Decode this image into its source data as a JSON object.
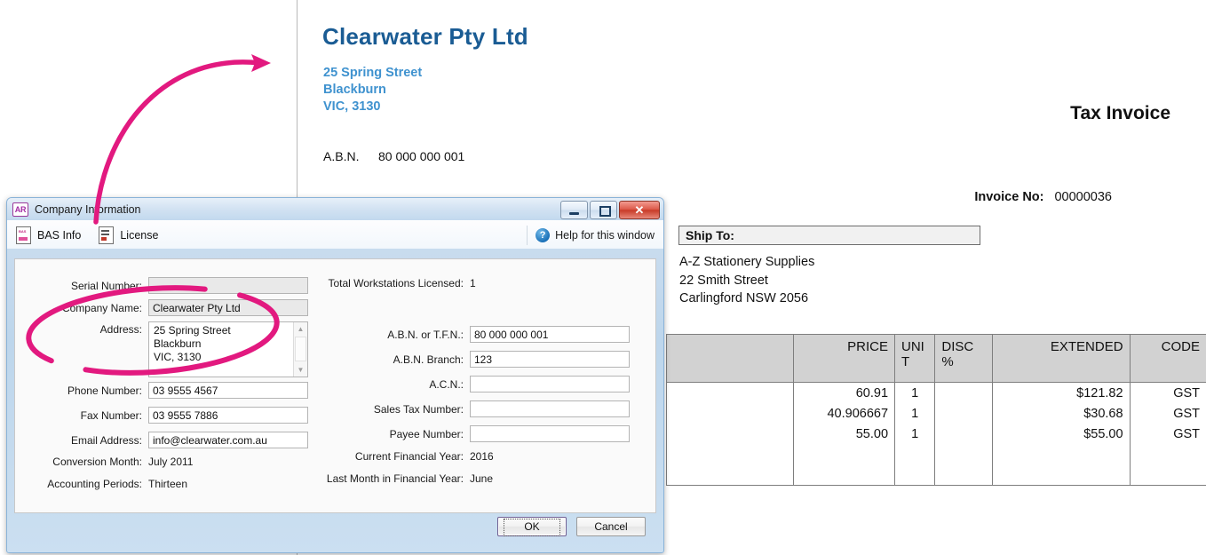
{
  "invoice": {
    "company_name": "Clearwater Pty Ltd",
    "company_address": "25 Spring Street\nBlackburn\nVIC, 3130",
    "abn_label": "A.B.N.",
    "abn_value": "80 000 000 001",
    "doc_title": "Tax Invoice",
    "invoice_no_label": "Invoice No:",
    "invoice_no_value": "00000036",
    "ship_to_label": "Ship To:",
    "ship_to_address": "A-Z Stationery Supplies\n22 Smith Street\nCarlingford  NSW  2056",
    "table": {
      "headers": [
        "",
        "PRICE",
        "UNI\nT",
        "DISC\n%",
        "EXTENDED",
        "CODE"
      ],
      "rows": [
        {
          "desc": "",
          "price": "60.91",
          "unit": "1",
          "disc": "",
          "extended": "$121.82",
          "code": "GST"
        },
        {
          "desc": "",
          "price": "40.906667",
          "unit": "1",
          "disc": "",
          "extended": "$30.68",
          "code": "GST"
        },
        {
          "desc": "",
          "price": "55.00",
          "unit": "1",
          "disc": "",
          "extended": "$55.00",
          "code": "GST"
        }
      ]
    }
  },
  "dialog": {
    "title": "Company Information",
    "app_icon_text": "AR",
    "window_buttons": {
      "minimize": "–",
      "maximize": "□",
      "close": "✕"
    },
    "toolbar": {
      "bas_info": "BAS Info",
      "license": "License",
      "help": "Help for this window",
      "help_icon_glyph": "?"
    },
    "fields": {
      "serial_number_label": "Serial Number:",
      "serial_number_value": "",
      "company_name_label": "Company Name:",
      "company_name_value": "Clearwater Pty Ltd",
      "address_label": "Address:",
      "address_value": "25 Spring Street\nBlackburn\nVIC, 3130",
      "phone_label": "Phone Number:",
      "phone_value": "03 9555 4567",
      "fax_label": "Fax Number:",
      "fax_value": "03 9555 7886",
      "email_label": "Email Address:",
      "email_value": "info@clearwater.com.au",
      "conversion_month_label": "Conversion Month:",
      "conversion_month_value": "July 2011",
      "accounting_periods_label": "Accounting Periods:",
      "accounting_periods_value": "Thirteen",
      "total_workstations_label": "Total Workstations Licensed:",
      "total_workstations_value": "1",
      "abn_tfn_label": "A.B.N. or T.F.N.:",
      "abn_tfn_value": "80 000 000 001",
      "abn_branch_label": "A.B.N. Branch:",
      "abn_branch_value": "123",
      "acn_label": "A.C.N.:",
      "acn_value": "",
      "sales_tax_label": "Sales Tax Number:",
      "sales_tax_value": "",
      "payee_number_label": "Payee Number:",
      "payee_number_value": "",
      "current_fy_label": "Current Financial Year:",
      "current_fy_value": "2016",
      "last_month_fy_label": "Last Month in Financial Year:",
      "last_month_fy_value": "June"
    },
    "buttons": {
      "ok": "OK",
      "cancel": "Cancel"
    }
  },
  "annotation": {
    "color": "#e2197f",
    "arrow_name": "pink-curved-arrow",
    "ellipse_name": "pink-ellipse-highlight"
  }
}
